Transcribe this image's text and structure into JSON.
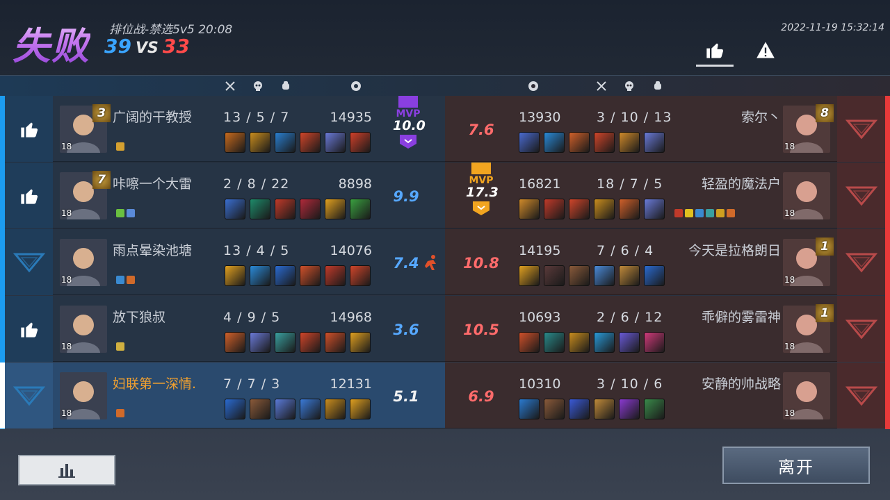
{
  "header": {
    "result": "失败",
    "mode": "排位战-禁选5v5",
    "duration": "20:08",
    "score_blue": "39",
    "score_vs": "VS",
    "score_red": "33",
    "datetime": "2022-11-19 15:32:14"
  },
  "icons": {
    "like": "thumbs-up-icon",
    "report": "warning-icon",
    "kills": "crossed-swords-icon",
    "deaths": "skull-icon",
    "assists": "fist-icon",
    "damage": "shield-icon",
    "upvote": "thumbs-up-icon",
    "downvote": "triangle-down-icon",
    "stats": "bar-chart-icon"
  },
  "colors": {
    "blue_team": "#1c9cf0",
    "red_team": "#e83a3a",
    "mvp_blue": "#8a3fe0",
    "mvp_gold": "#f2a520",
    "self_name": "#f0a030"
  },
  "blue_team": [
    {
      "name": "广阔的干教授",
      "level": "18",
      "badge": "3",
      "kills": "13",
      "deaths": "5",
      "assists": "7",
      "damage": "14935",
      "rating": "10.0",
      "mvp": true,
      "mvp_label": "MVP",
      "reaction": "like",
      "tags": [
        "#d4a030"
      ],
      "items": [
        "#c76a1e",
        "#c98d1e",
        "#2a7fd0",
        "#d0452a",
        "#6a7ad8",
        "#d0402a"
      ]
    },
    {
      "name": "咔嚓一个大雷",
      "level": "18",
      "badge": "7",
      "kills": "2",
      "deaths": "8",
      "assists": "22",
      "damage": "8898",
      "rating": "9.9",
      "mvp": false,
      "reaction": "like",
      "tags": [
        "#6ac040",
        "#5a8ad8"
      ],
      "items": [
        "#3a6ed0",
        "#1e8a6a",
        "#c03a2a",
        "#b02a3a",
        "#e0a020",
        "#3aa040"
      ]
    },
    {
      "name": "雨点晕染池塘",
      "level": "18",
      "badge": "",
      "kills": "13",
      "deaths": "4",
      "assists": "5",
      "damage": "14076",
      "rating": "7.4",
      "mvp": false,
      "reaction": "down",
      "tags": [
        "#3a8ad0",
        "#d06a2a"
      ],
      "items": [
        "#e0a020",
        "#2a8ad8",
        "#2a6ad0",
        "#d0502a",
        "#c03a2a",
        "#d0452a"
      ]
    },
    {
      "name": "放下狼叔",
      "level": "18",
      "badge": "",
      "kills": "4",
      "deaths": "9",
      "assists": "5",
      "damage": "14968",
      "rating": "3.6",
      "mvp": false,
      "reaction": "like",
      "tags": [
        "#d0b040"
      ],
      "items": [
        "#d0602a",
        "#6a7ad8",
        "#3aa0a0",
        "#d0452a",
        "#d0502a",
        "#e0a020"
      ]
    },
    {
      "name": "妇联第一深情.",
      "level": "18",
      "badge": "",
      "kills": "7",
      "deaths": "7",
      "assists": "3",
      "damage": "12131",
      "rating": "5.1",
      "mvp": false,
      "reaction": "down",
      "self": true,
      "tags": [
        "#d06a2a"
      ],
      "items": [
        "#2a6ad0",
        "#8a5a3a",
        "#5a7ad8",
        "#3a7ad8",
        "#c98d1e",
        "#e0a020"
      ]
    }
  ],
  "red_team": [
    {
      "name": "索尔丶",
      "level": "18",
      "badge": "8",
      "kills": "3",
      "deaths": "10",
      "assists": "13",
      "damage": "13930",
      "rating": "7.6",
      "mvp": false,
      "tags": [],
      "items": [
        "#4a6ad0",
        "#2a8ad8",
        "#d0602a",
        "#d0452a",
        "#d08a2a",
        "#6a7ad8"
      ]
    },
    {
      "name": "轻盈的魔法户",
      "level": "18",
      "badge": "",
      "kills": "18",
      "deaths": "7",
      "assists": "5",
      "damage": "16821",
      "rating": "17.3",
      "mvp": true,
      "mvp_label": "MVP",
      "tags": [
        "#c03a2a",
        "#e0c020",
        "#3a8ad0",
        "#3aa0a0",
        "#d0a020",
        "#d06a2a"
      ],
      "items": [
        "#d08a2a",
        "#c03a2a",
        "#d0452a",
        "#c98d1e",
        "#d0602a",
        "#6a7ad8"
      ]
    },
    {
      "name": "今天是拉格朗日",
      "level": "18",
      "badge": "1",
      "kills": "7",
      "deaths": "6",
      "assists": "4",
      "damage": "14195",
      "rating": "10.8",
      "mvp": false,
      "tags": [],
      "items": [
        "#e0a020",
        "#5a3a3a",
        "#8a5a3a",
        "#4a8ad8",
        "#c08a3a",
        "#2a6ad0"
      ]
    },
    {
      "name": "乖僻的雾雷神",
      "level": "18",
      "badge": "1",
      "kills": "2",
      "deaths": "6",
      "assists": "12",
      "damage": "10693",
      "rating": "10.5",
      "mvp": false,
      "tags": [],
      "items": [
        "#d0502a",
        "#2a8a8a",
        "#c98d1e",
        "#2a9ad8",
        "#6a5ad8",
        "#d03a7a"
      ]
    },
    {
      "name": "安静的帅战略",
      "level": "18",
      "badge": "",
      "kills": "3",
      "deaths": "10",
      "assists": "6",
      "damage": "10310",
      "rating": "6.9",
      "mvp": false,
      "tags": [],
      "items": [
        "#2a7ad0",
        "#8a5a3a",
        "#3a5ad8",
        "#c08a3a",
        "#8a3ad0",
        "#3a8a4a"
      ]
    }
  ],
  "footer": {
    "leave_label": "离开"
  }
}
